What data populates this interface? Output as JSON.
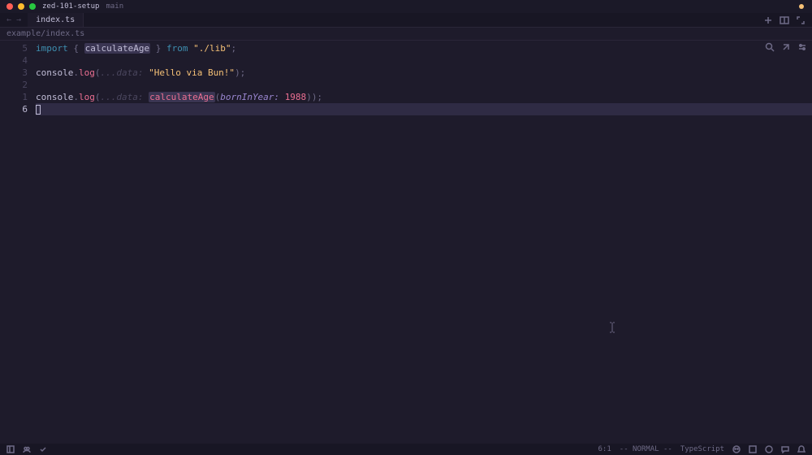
{
  "titlebar": {
    "project": "zed-101-setup",
    "branch": "main"
  },
  "tabs": {
    "active": "index.ts"
  },
  "breadcrumb": "example/index.ts",
  "gutter": [
    "5",
    "4",
    "3",
    "2",
    "1",
    "6"
  ],
  "code": {
    "l1": {
      "kw1": "import",
      "brace1": " { ",
      "ident": "calculateAge",
      "brace2": " } ",
      "kw2": "from",
      "sp": " ",
      "str": "\"./lib\"",
      "semi": ";"
    },
    "l3": {
      "obj": "console",
      "dot": ".",
      "fn": "log",
      "open": "(",
      "hint": "...data: ",
      "str": "\"Hello via Bun!\"",
      "close": ");"
    },
    "l5": {
      "obj": "console",
      "dot": ".",
      "fn": "log",
      "open": "(",
      "hint": "...data: ",
      "call": "calculateAge",
      "open2": "(",
      "param": "bornInYear: ",
      "num": "1988",
      "close2": ")",
      "close": ");"
    }
  },
  "status": {
    "pos": "6:1",
    "mode": "-- NORMAL --",
    "lang": "TypeScript"
  }
}
